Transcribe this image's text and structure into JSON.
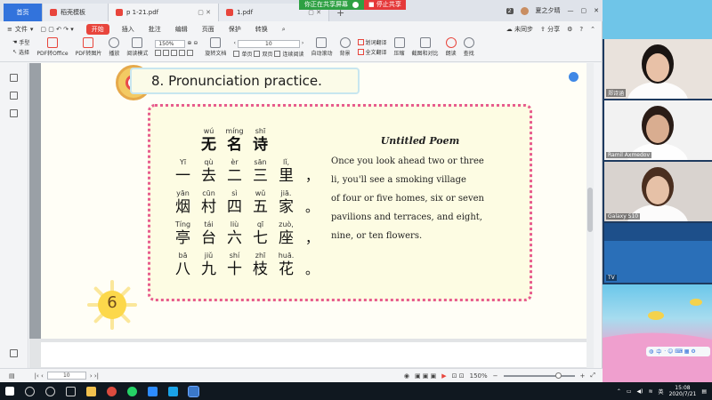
{
  "share": {
    "status_label": "你正在共享屏幕",
    "stop_label": "停止共享"
  },
  "tabs": [
    {
      "label": "首页",
      "type": "home"
    },
    {
      "label": "稻壳模板",
      "type": "inactive",
      "icon_color": "#e8453c"
    },
    {
      "label": "p 1-21.pdf",
      "type": "active",
      "icon_color": "#e8453c"
    },
    {
      "label": "1.pdf",
      "type": "inactive",
      "icon_color": "#e8453c"
    }
  ],
  "window_right": {
    "count": "2",
    "user": "夏之夕晴"
  },
  "menu": {
    "file": "文件",
    "items": [
      "开始",
      "插入",
      "批注",
      "编辑",
      "页面",
      "保护",
      "转换"
    ],
    "sync": "未同步",
    "share": "分享"
  },
  "ribbon": {
    "hand": "手型",
    "select": "选择",
    "pdf_to_office": "PDF转Office",
    "pdf_to_image": "PDF转图片",
    "play": "播放",
    "read_mode": "阅读模式",
    "zoom": "150%",
    "rotate": "旋转文档",
    "page_value": "10",
    "single": "单页",
    "double": "双页",
    "continuous": "连续阅读",
    "auto_scroll": "自动滚动",
    "background": "背景",
    "word_translate": "划词翻译",
    "full_translate": "全文翻译",
    "compress": "压缩",
    "screenshot_compare": "截图和对比",
    "read_aloud": "朗读",
    "find": "查找"
  },
  "page": {
    "section_title": "8. Pronunciation practice.",
    "poem_title_cn": [
      {
        "py": "wú",
        "hz": "无"
      },
      {
        "py": "míng",
        "hz": "名"
      },
      {
        "py": "shī",
        "hz": "诗"
      }
    ],
    "poem_lines": [
      [
        {
          "py": "Yī",
          "hz": "一"
        },
        {
          "py": "qù",
          "hz": "去"
        },
        {
          "py": "èr",
          "hz": "二"
        },
        {
          "py": "sān",
          "hz": "三"
        },
        {
          "py": "lǐ,",
          "hz": "里"
        },
        {
          "py": "",
          "hz": "，"
        }
      ],
      [
        {
          "py": "yān",
          "hz": "烟"
        },
        {
          "py": "cūn",
          "hz": "村"
        },
        {
          "py": "sì",
          "hz": "四"
        },
        {
          "py": "wǔ",
          "hz": "五"
        },
        {
          "py": "jiā.",
          "hz": "家"
        },
        {
          "py": "",
          "hz": "。"
        }
      ],
      [
        {
          "py": "Tíng",
          "hz": "亭"
        },
        {
          "py": "tái",
          "hz": "台"
        },
        {
          "py": "liù",
          "hz": "六"
        },
        {
          "py": "qī",
          "hz": "七"
        },
        {
          "py": "zuò,",
          "hz": "座"
        },
        {
          "py": "",
          "hz": "，"
        }
      ],
      [
        {
          "py": "bā",
          "hz": "八"
        },
        {
          "py": "jiǔ",
          "hz": "九"
        },
        {
          "py": "shí",
          "hz": "十"
        },
        {
          "py": "zhī",
          "hz": "枝"
        },
        {
          "py": "huā.",
          "hz": "花"
        },
        {
          "py": "",
          "hz": "。"
        }
      ]
    ],
    "poem_title_en": "Untitled Poem",
    "poem_text_en": [
      "Once you look ahead two or three",
      "li, you'll see a smoking village",
      "of four or five homes, six or seven",
      "pavilions and terraces, and eight,",
      "nine, or ten flowers."
    ],
    "page_number": "6"
  },
  "statusbar": {
    "page_value": "10",
    "zoom": "150%"
  },
  "taskbar": {
    "time": "15:08",
    "date": "2020/7/21"
  },
  "video_tiles": [
    {
      "name": "郑诗涵",
      "bg": "#e9e2dc",
      "face": "#e8c1a7",
      "hair": "#1a1412"
    },
    {
      "name": "Ramil Axmedov",
      "bg": "#f2f2f2",
      "face": "#d9ad90",
      "hair": "#2a1c16"
    },
    {
      "name": "Galaxy S10",
      "bg": "#d9d3cf",
      "face": "#e6c1a7",
      "hair": "#4a2e1f"
    },
    {
      "name": "TV",
      "bg": "#2a6fb8",
      "face": "",
      "hair": ""
    }
  ],
  "floating_bar": "中"
}
